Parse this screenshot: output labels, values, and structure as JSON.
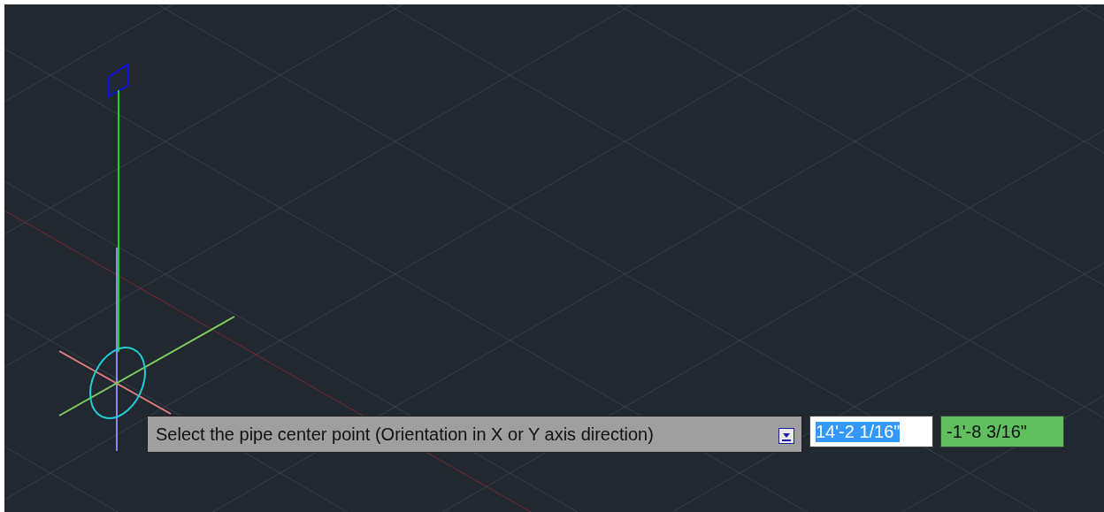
{
  "viewport": {
    "prompt": {
      "text": "Select the pipe center point (Orientation in X or Y axis direction)"
    },
    "inputs": [
      {
        "value": "14'-2 1/16\"",
        "selected": true
      },
      {
        "value": "-1'-8 3/16\"",
        "selected": false
      }
    ]
  }
}
